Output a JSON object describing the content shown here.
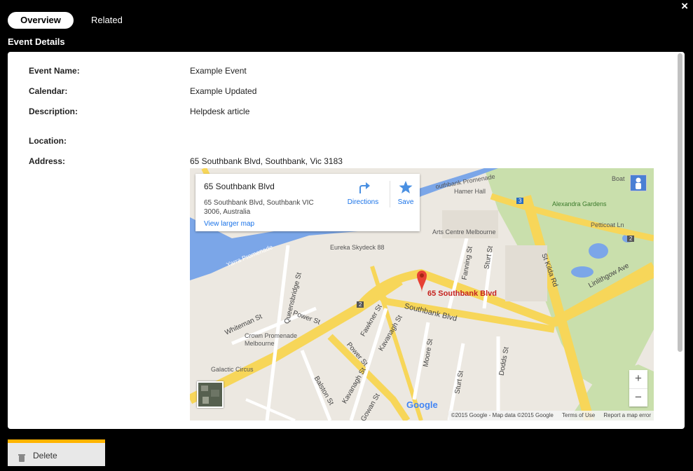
{
  "tabs": [
    {
      "label": "Overview",
      "active": true
    },
    {
      "label": "Related",
      "active": false
    }
  ],
  "close_label": "×",
  "section_title": "Event Details",
  "fields": {
    "event_name": {
      "label": "Event Name:",
      "value": "Example Event"
    },
    "calendar": {
      "label": "Calendar:",
      "value": "Example Updated"
    },
    "description": {
      "label": "Description:",
      "value": "Helpdesk article"
    },
    "location": {
      "label": "Location:",
      "value": ""
    },
    "address": {
      "label": "Address:",
      "value": "65 Southbank Blvd, Southbank, Vic 3183"
    }
  },
  "map": {
    "info_title": "65 Southbank Blvd",
    "info_address": "65 Southbank Blvd, Southbank VIC 3006, Australia",
    "view_larger": "View larger map",
    "directions": "Directions",
    "save": "Save",
    "pin_label": "65 Southbank Blvd",
    "places": {
      "hamer_hall": "Hamer Hall",
      "arts_centre": "Arts Centre Melbourne",
      "eureka": "Eureka Skydeck 88",
      "alexandra": "Alexandra Gardens",
      "crown": "Crown Promenade\nMelbourne",
      "galactic": "Galactic Circus",
      "southbank_prom": "outhbank Promenade",
      "yarra_prom": "Yarra Promenade",
      "boathouse": "Boat",
      "petticoat": "Petticoat Ln"
    },
    "streets": {
      "southbank_blvd": "Southbank Blvd",
      "st_kilda": "St Kilda Rd",
      "linlithgow": "Linlithgow Ave",
      "queensbridge": "Queensbridge St",
      "power1": "Power St",
      "power2": "Power St",
      "whiteman": "Whiteman St",
      "fawkner": "Fawkner St",
      "kavanagh1": "Kavanagh St",
      "kavanagh2": "Kavanagh St",
      "moore": "Moore St",
      "sturt1": "Sturt St",
      "sturt2": "Sturt St",
      "fanning": "Fanning St",
      "dodds": "Dodds St",
      "balston": "Balston St",
      "mcgowan": "Gowan St"
    },
    "shields": {
      "a": "2",
      "b": "3",
      "c": "2"
    },
    "zoom_in": "+",
    "zoom_out": "−",
    "google_logo": "Google",
    "attribution": "©2015 Google - Map data ©2015 Google",
    "terms": "Terms of Use",
    "report": "Report a map error",
    "colors": {
      "road": "#f7d659",
      "water": "#7ba6e8",
      "park": "#c9dfac",
      "land": "#ece8e1",
      "pin": "#e64134"
    }
  },
  "delete_label": "Delete",
  "colors": {
    "accent": "#ffb400",
    "background": "#000000"
  }
}
